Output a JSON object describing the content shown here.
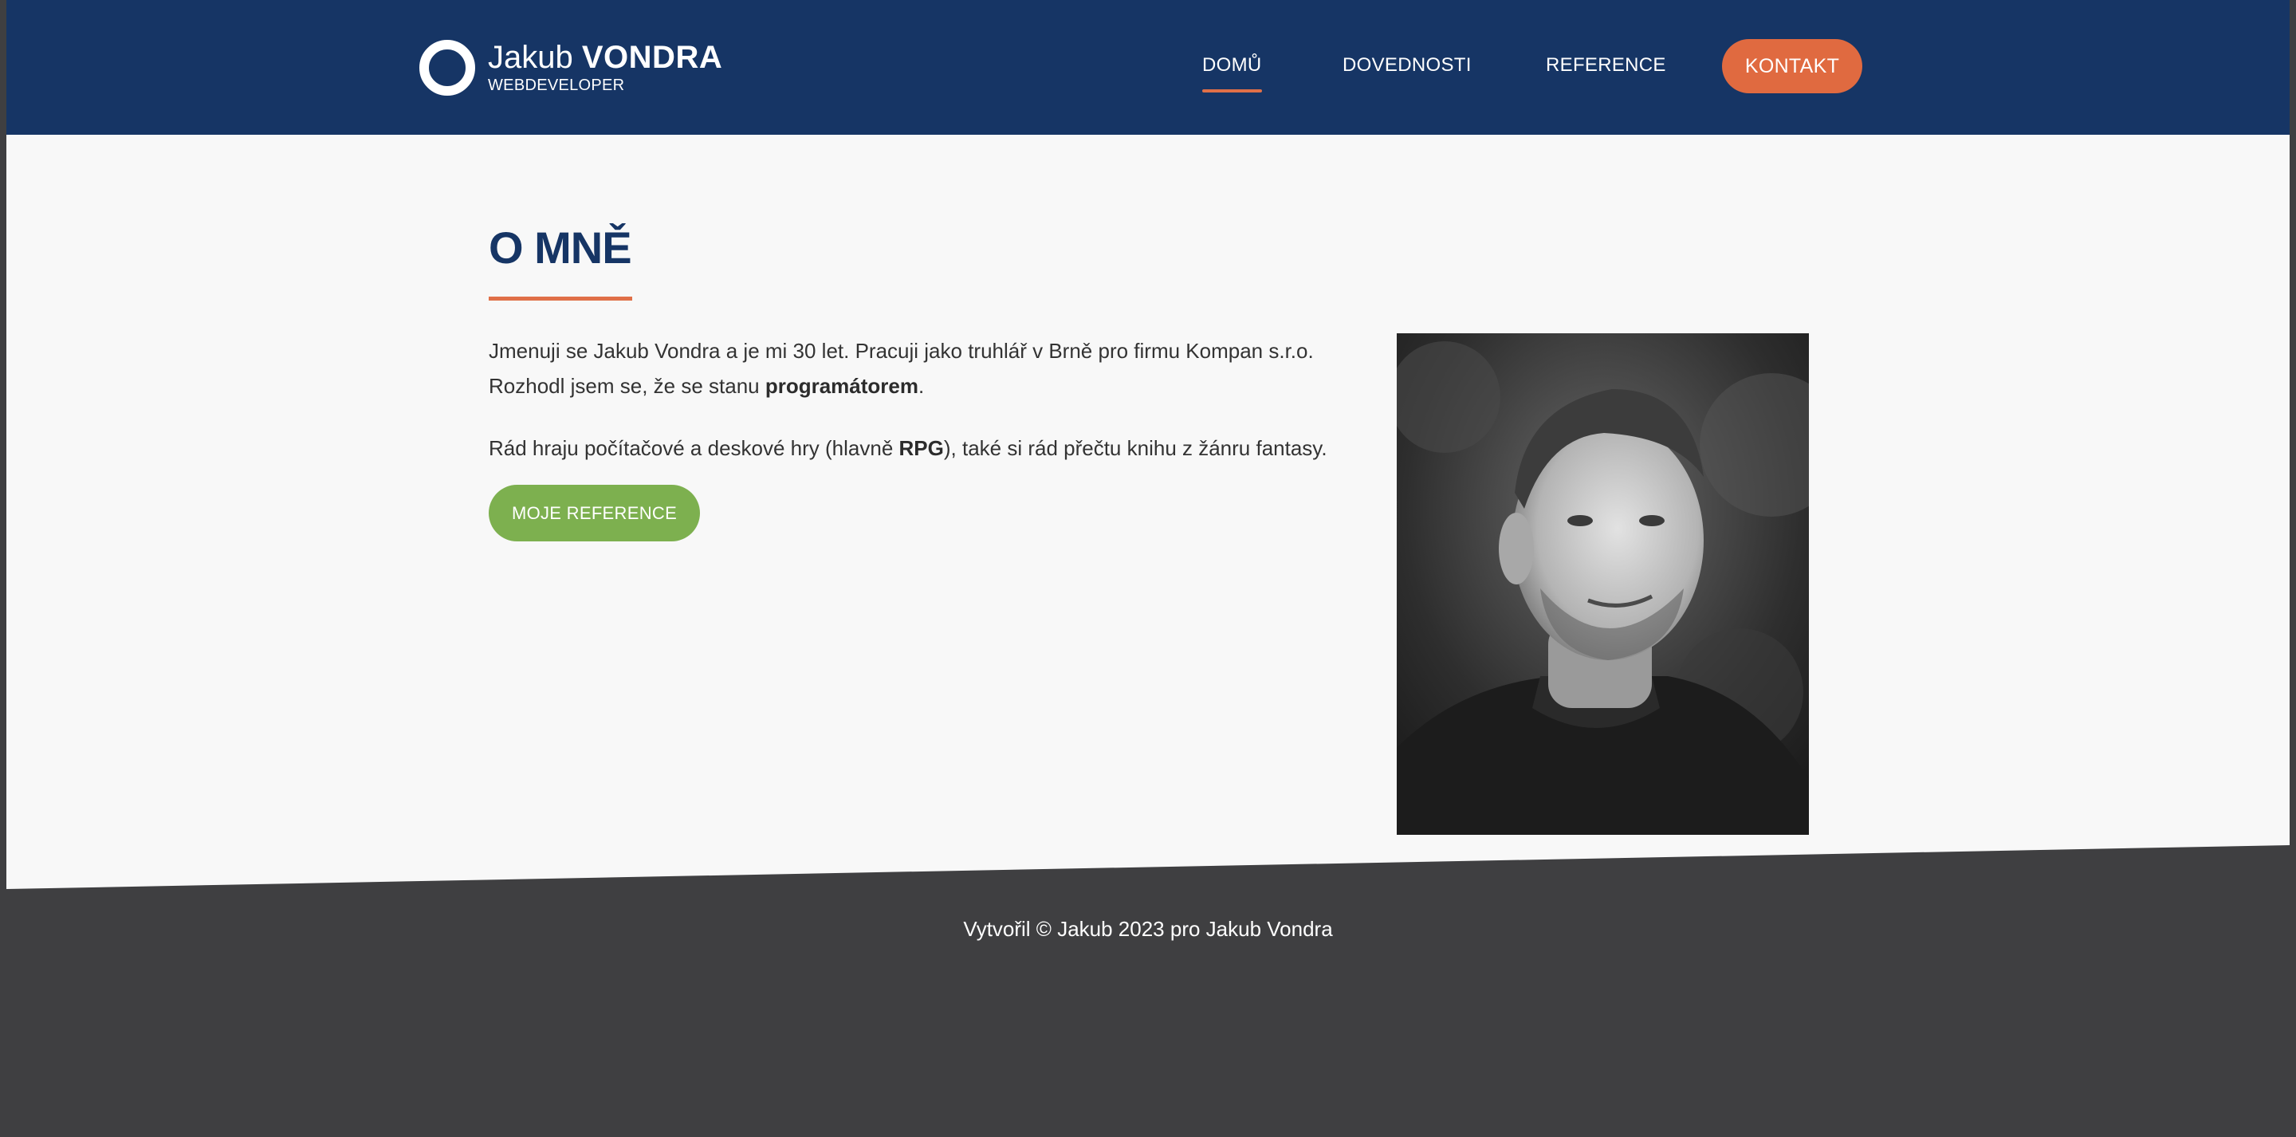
{
  "brand": {
    "first_name": "Jakub",
    "last_name": "VONDRA",
    "tagline": "WEBDEVELOPER"
  },
  "nav": {
    "items": [
      {
        "label": "DOMŮ",
        "active": true
      },
      {
        "label": "DOVEDNOSTI",
        "active": false
      },
      {
        "label": "REFERENCE",
        "active": false
      }
    ],
    "contact_label": "KONTAKT"
  },
  "about": {
    "title": "O MNĚ",
    "p1_a": "Jmenuji se Jakub Vondra a je mi 30 let. Pracuji jako truhlář v Brně pro firmu Kompan s.r.o. Rozhodl jsem se, že se stanu ",
    "p1_b": "programátorem",
    "p1_c": ".",
    "p2_a": "Rád hraju počítačové a deskové hry (hlavně ",
    "p2_b": "RPG",
    "p2_c": "), také si rád přečtu knihu z žánru fantasy.",
    "button_label": "MOJE REFERENCE"
  },
  "footer": {
    "text": "Vytvořil © Jakub 2023 pro Jakub Vondra"
  },
  "colors": {
    "header_bg": "#163565",
    "accent_orange": "#e06a40",
    "accent_green": "#7db04f",
    "footer_bg": "#3f3f41",
    "content_bg": "#f8f8f8"
  }
}
